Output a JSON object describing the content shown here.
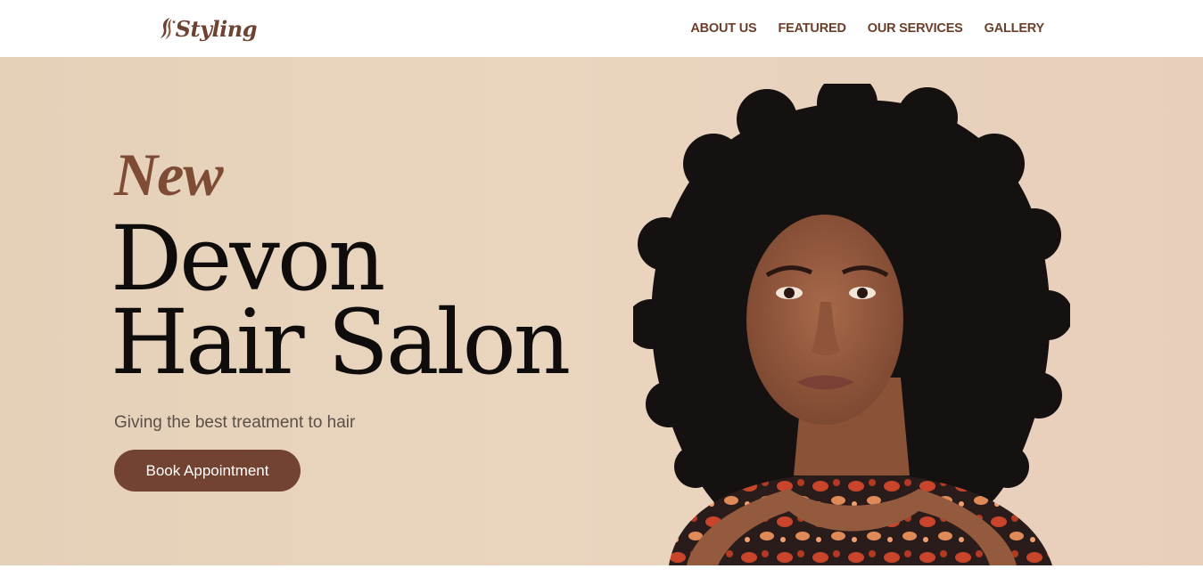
{
  "header": {
    "logo_text": "Styling",
    "nav": [
      "ABOUT US",
      "FEATURED",
      "OUR SERVICES",
      "GALLERY"
    ]
  },
  "hero": {
    "eyebrow": "New",
    "title_line1": "Devon",
    "title_line2": "Hair Salon",
    "subtitle": "Giving the best treatment to hair",
    "cta_label": "Book Appointment"
  },
  "colors": {
    "brand_brown": "#734331",
    "nav_text": "#6b3f2c",
    "hero_bg": "#e9d3bd",
    "title": "#0f0d0c"
  },
  "icons": {
    "logo": "woman-silhouette-logo-icon"
  }
}
